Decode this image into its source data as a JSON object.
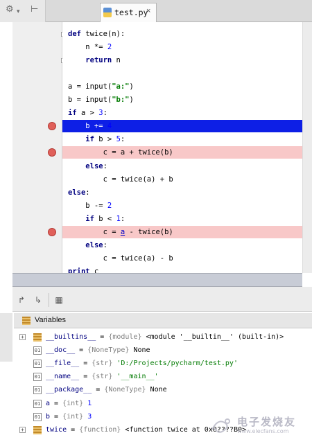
{
  "editor": {
    "tab_label": "test.py",
    "tab_close": "×",
    "code_lines": [
      "def twice(n):",
      "    n *= 2",
      "    return n",
      "",
      "a = input(\"a:\")",
      "b = input(\"b:\")",
      "if a > 3:",
      "    b += 4",
      "    if b > 5:",
      "        c = a + twice(b)",
      "    else:",
      "        c = twice(a) + b",
      "else:",
      "    b -= 2",
      "    if b < 1:",
      "        c = a - twice(b)",
      "    else:",
      "        c = twice(a) - b",
      "print c"
    ],
    "breakpoint_lines": [
      7,
      9,
      15
    ],
    "current_line": 7
  },
  "debugger": {
    "variables_title": "Variables",
    "variables": [
      {
        "name": "__builtins__",
        "type": "{module}",
        "value": "<module '__builtin__' (built-in)>",
        "expandable": true,
        "icon": "module-icon"
      },
      {
        "name": "__doc__",
        "type": "{NoneType}",
        "value": "None",
        "expandable": false,
        "icon": "variable-icon"
      },
      {
        "name": "__file__",
        "type": "{str}",
        "value": "'D:/Projects/pycharm/test.py'",
        "expandable": false,
        "icon": "variable-icon"
      },
      {
        "name": "__name__",
        "type": "{str}",
        "value": "'__main__'",
        "expandable": false,
        "icon": "variable-icon"
      },
      {
        "name": "__package__",
        "type": "{NoneType}",
        "value": "None",
        "expandable": false,
        "icon": "variable-icon"
      },
      {
        "name": "a",
        "type": "{int}",
        "value": "1",
        "expandable": false,
        "icon": "variable-icon"
      },
      {
        "name": "b",
        "type": "{int}",
        "value": "3",
        "expandable": false,
        "icon": "variable-icon"
      },
      {
        "name": "twice",
        "type": "{function}",
        "value": "<function twice at 0x0????B0>",
        "expandable": true,
        "icon": "module-icon"
      }
    ]
  },
  "watermark": {
    "text": "电子发烧友",
    "url": "www.elecfans.com"
  }
}
